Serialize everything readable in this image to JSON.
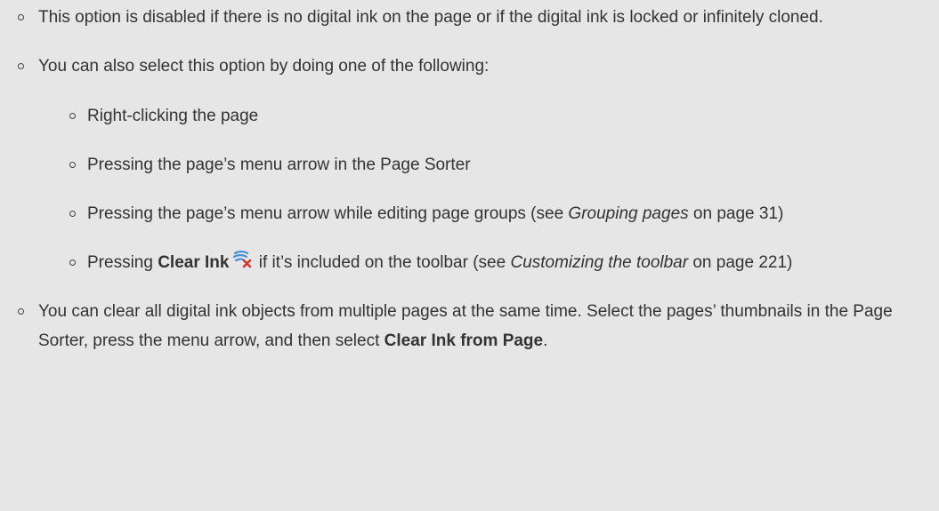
{
  "items": [
    {
      "text": "This option is disabled if there is no digital ink on the page or if the digital ink is locked or infinitely cloned."
    },
    {
      "text": "You can also select this option by doing one of the following:",
      "subitems": {
        "right_click": "Right-clicking the page",
        "page_sorter": "Pressing the page’s menu arrow in the Page Sorter",
        "groups_prefix": "Pressing the page’s menu arrow while editing page groups (see ",
        "groups_link": "Grouping pages",
        "groups_suffix": " on page 31)",
        "clear_prefix": "Pressing ",
        "clear_bold": "Clear Ink",
        "clear_mid": " if it’s included on the toolbar (see ",
        "clear_link": "Customizing the toolbar",
        "clear_suffix": " on page 221)"
      }
    },
    {
      "text_prefix": "You can clear all digital ink objects from multiple pages at the same time. Select the pages’ thumbnails in the Page Sorter, press the menu arrow, and then select ",
      "text_bold": "Clear Ink from Page",
      "text_suffix": "."
    }
  ],
  "icons": {
    "clear_ink": "clear-ink-icon"
  },
  "colors": {
    "background": "#e6e6e6",
    "text": "#333333",
    "icon_blue": "#4a8fd6",
    "icon_red": "#d9342b"
  }
}
